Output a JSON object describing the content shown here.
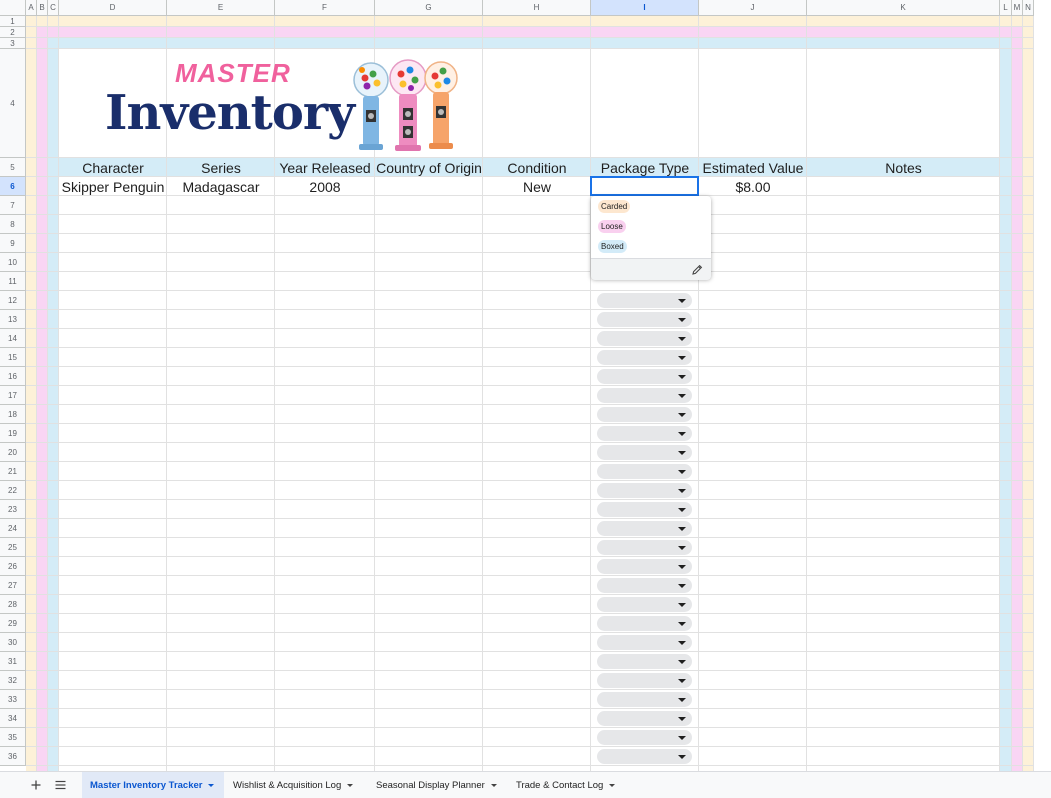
{
  "columns": [
    "A",
    "B",
    "C",
    "D",
    "E",
    "F",
    "G",
    "H",
    "I",
    "J",
    "K",
    "L",
    "M",
    "N"
  ],
  "rows": [
    "1",
    "2",
    "3",
    "4",
    "5",
    "6",
    "7",
    "8",
    "9",
    "10",
    "11",
    "12",
    "13",
    "14",
    "15",
    "16",
    "17",
    "18",
    "19",
    "20",
    "21",
    "22",
    "23",
    "24",
    "25",
    "26",
    "27",
    "28",
    "29",
    "30",
    "31",
    "32",
    "33",
    "34",
    "35",
    "36"
  ],
  "selected_cell": {
    "column": "I",
    "row": "6"
  },
  "colors": {
    "band_yellow": "#fdf1d8",
    "band_pink": "#f9d5f4",
    "band_blue": "#d4ecf7",
    "title_pink": "#f0619d",
    "title_navy": "#1a2e6b",
    "chip_carded": "#fde7cf",
    "chip_loose": "#f9d0ef",
    "chip_boxed": "#d3ebf8",
    "selection_blue": "#1a73e8"
  },
  "banner": {
    "title_top": "MASTER",
    "title_main": "Inventory",
    "image": "gumball-machines"
  },
  "headers": [
    "Character",
    "Series",
    "Year Released",
    "Country of Origin",
    "Condition",
    "Package Type",
    "Estimated Value",
    "Notes"
  ],
  "row6": {
    "character": "Skipper Penguin",
    "series": "Madagascar",
    "year": "2008",
    "country": "",
    "condition": "New",
    "package": "",
    "value": "$8.00",
    "notes": ""
  },
  "dropdown_options": [
    "Carded",
    "Loose",
    "Boxed"
  ],
  "tabs": [
    "Master Inventory Tracker",
    "Wishlist & Acquisition Log",
    "Seasonal Display Planner",
    "Trade & Contact Log"
  ],
  "icons": {
    "add_sheet": "plus-icon",
    "all_sheets": "list-icon",
    "edit": "pencil-icon"
  }
}
